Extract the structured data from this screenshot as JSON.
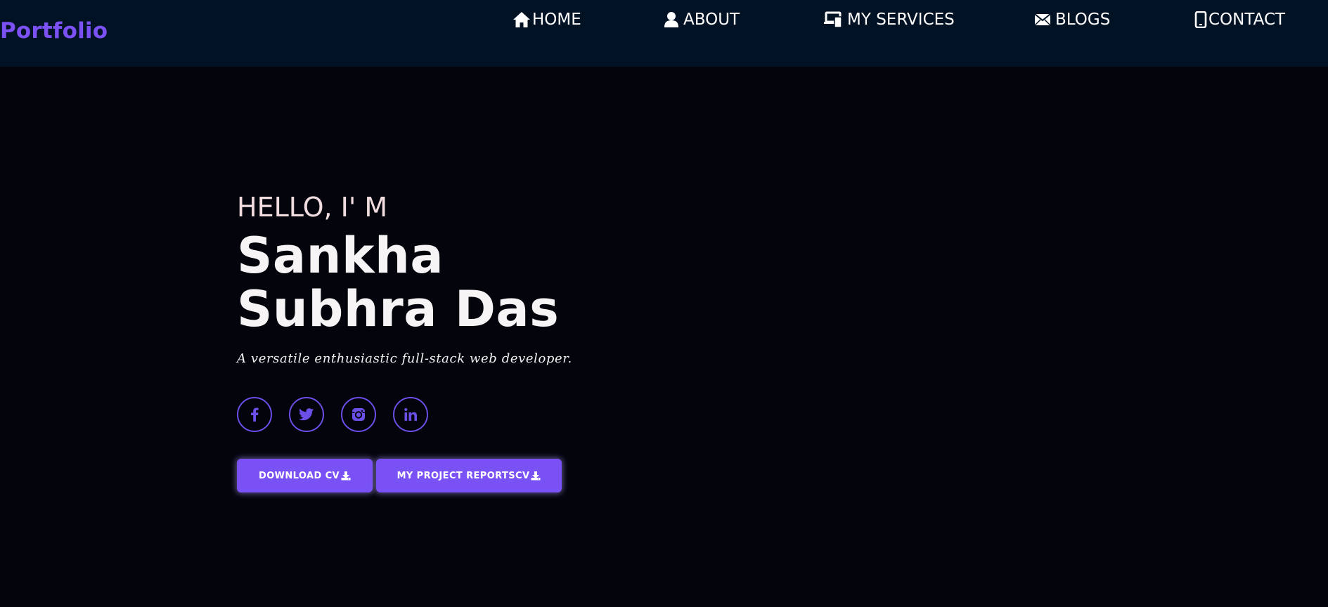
{
  "brand": {
    "logo": "Portfolio",
    "accent": "#7b51f3"
  },
  "nav": {
    "items": [
      {
        "label": "HOME",
        "icon": "home-icon"
      },
      {
        "label": "ABOUT",
        "icon": "user-icon"
      },
      {
        "label": "MY SERVICES",
        "icon": "devices-icon"
      },
      {
        "label": "BLOGS",
        "icon": "envelope-icon"
      },
      {
        "label": "CONTACT",
        "icon": "mobile-icon"
      }
    ]
  },
  "hero": {
    "greeting": "HELLO, I' M",
    "name_line1": "Sankha",
    "name_line2": "Subhra Das",
    "tagline": "A versatile enthusiastic full-stack web developer."
  },
  "socials": [
    {
      "icon": "facebook-icon"
    },
    {
      "icon": "twitter-icon"
    },
    {
      "icon": "instagram-icon"
    },
    {
      "icon": "linkedin-icon"
    }
  ],
  "buttons": {
    "download_cv": "DOWNLOAD CV",
    "project_reports": "MY PROJECT REPORTSCV",
    "icon": "download-icon"
  },
  "colors": {
    "nav_bg": "#021225",
    "page_bg": "#03040c",
    "button_bg": "#7951f5",
    "social_border": "#6c4ee8"
  }
}
